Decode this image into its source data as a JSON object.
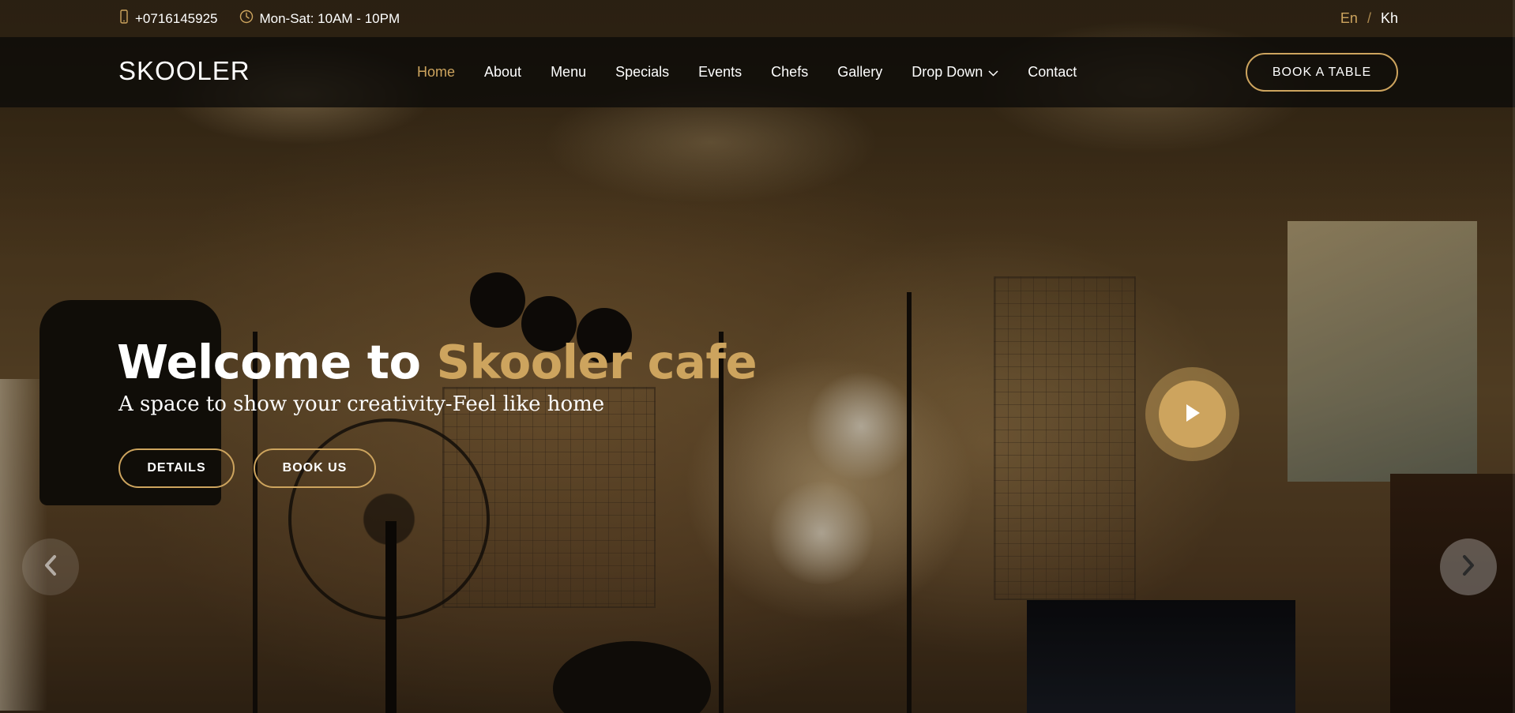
{
  "topbar": {
    "phone": "+0716145925",
    "hours": "Mon-Sat: 10AM - 10PM",
    "lang_active": "En",
    "lang_separator": "/",
    "lang_other": "Kh"
  },
  "header": {
    "logo": "SKOOLER",
    "nav": [
      {
        "label": "Home",
        "active": true
      },
      {
        "label": "About"
      },
      {
        "label": "Menu"
      },
      {
        "label": "Specials"
      },
      {
        "label": "Events"
      },
      {
        "label": "Chefs"
      },
      {
        "label": "Gallery"
      },
      {
        "label": "Drop Down",
        "has_dropdown": true
      },
      {
        "label": "Contact"
      }
    ],
    "cta": "BOOK A TABLE"
  },
  "hero": {
    "headline_start": "Welcome to ",
    "headline_accent": "Skooler cafe",
    "tagline": "A space to show your creativity-Feel like home",
    "buttons": {
      "details": "DETAILS",
      "book_us": "BOOK US"
    }
  },
  "icons": {
    "phone": "mobile-phone-icon",
    "clock": "clock-icon",
    "dropdown": "chevron-down-icon",
    "play": "play-icon",
    "prev": "chevron-left-icon",
    "next": "chevron-right-icon"
  },
  "colors": {
    "accent": "#cda45e",
    "header_bg": "rgba(12,11,9,0.8)",
    "text": "#ffffff"
  }
}
